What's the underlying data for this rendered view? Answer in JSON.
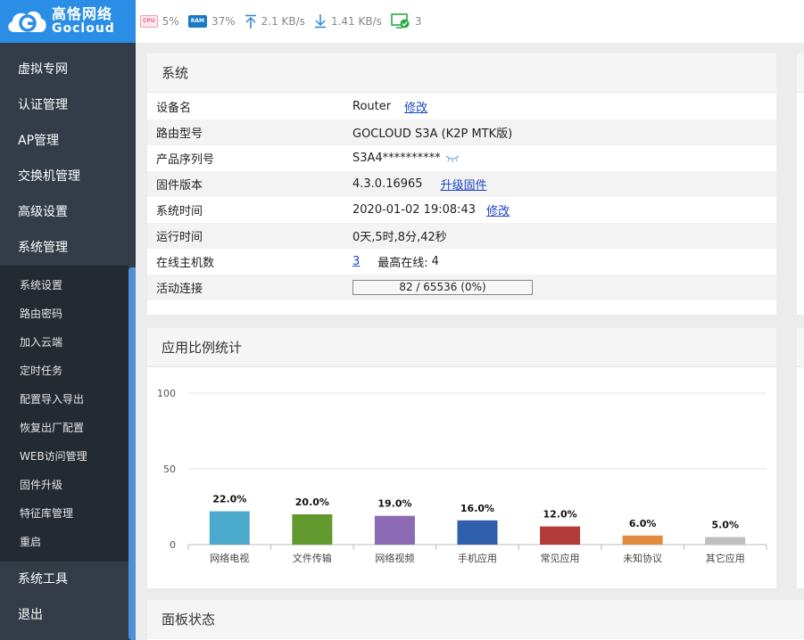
{
  "logo": {
    "cn": "高恪网络",
    "en": "Gocloud"
  },
  "topbar": {
    "cpu_chip": "CPU",
    "cpu": "5%",
    "ram_chip": "RAM",
    "ram": "37%",
    "upload": "2.1 KB/s",
    "download": "1.41 KB/s",
    "devices": "3"
  },
  "sidebar": {
    "top_items": [
      "虚拟专网",
      "认证管理",
      "AP管理",
      "交换机管理",
      "高级设置",
      "系统管理"
    ],
    "sub_items": [
      "系统设置",
      "路由密码",
      "加入云端",
      "定时任务",
      "配置导入导出",
      "恢复出厂配置",
      "WEB访问管理",
      "固件升级",
      "特征库管理",
      "重启"
    ],
    "bottom_items": [
      "系统工具",
      "退出"
    ]
  },
  "system": {
    "title": "系统",
    "device_name_label": "设备名",
    "device_name": "Router",
    "device_name_edit": "修改",
    "model_label": "路由型号",
    "model": "GOCLOUD S3A (K2P MTK版)",
    "serial_label": "产品序列号",
    "serial": "S3A4**********",
    "firmware_label": "固件版本",
    "firmware": "4.3.0.16965",
    "firmware_upgrade": "升级固件",
    "time_label": "系统时间",
    "time": "2020-01-02 19:08:43",
    "time_edit": "修改",
    "uptime_label": "运行时间",
    "uptime": "0天,5时,8分,42秒",
    "hosts_label": "在线主机数",
    "hosts": "3",
    "max_online_label": "最高在线:",
    "max_online": "4",
    "connections_label": "活动连接",
    "connections": "82 / 65536 (0%)",
    "connections_fraction": 0.0013
  },
  "app_stats": {
    "title": "应用比例统计"
  },
  "panel_status": {
    "title": "面板状态"
  },
  "chart_data": {
    "type": "bar",
    "categories": [
      "网络电视",
      "文件传输",
      "网络视频",
      "手机应用",
      "常见应用",
      "未知协议",
      "其它应用"
    ],
    "values": [
      22.0,
      20.0,
      19.0,
      16.0,
      12.0,
      6.0,
      5.0
    ],
    "value_labels": [
      "22.0%",
      "20.0%",
      "19.0%",
      "16.0%",
      "12.0%",
      "6.0%",
      "5.0%"
    ],
    "colors": [
      "#4ba9cc",
      "#62992f",
      "#8c6ab4",
      "#2f5faa",
      "#b23a39",
      "#e28b40",
      "#bfbfbf"
    ],
    "yticks": [
      "100",
      "50",
      "0"
    ],
    "ylim": [
      0,
      100
    ],
    "grid": true
  }
}
